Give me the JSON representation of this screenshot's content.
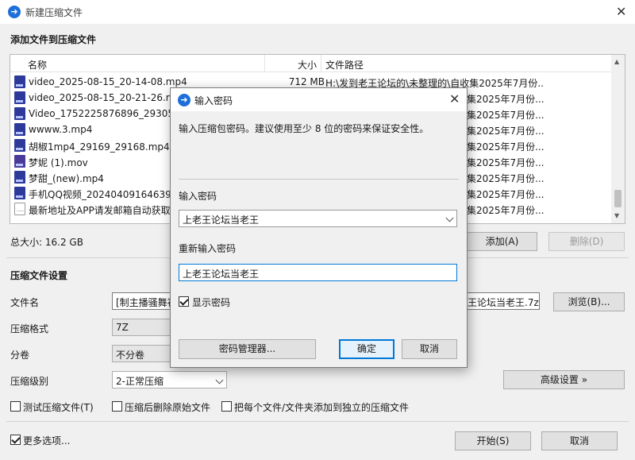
{
  "window": {
    "title": "新建压缩文件"
  },
  "add_section": {
    "title": "添加文件到压缩文件"
  },
  "file_list": {
    "columns": [
      "名称",
      "大小",
      "文件路径"
    ],
    "rows": [
      {
        "name": "video_2025-08-15_20-14-08.mp4",
        "size": "712 MB",
        "path": "H:\\发到老王论坛的\\未整理的\\自收集2025年7月份...",
        "type": "mp4"
      },
      {
        "name": "video_2025-08-15_20-21-26.mp4",
        "size": "",
        "path": "集2025年7月份...",
        "type": "mp4"
      },
      {
        "name": "Video_1752225876896_29305_2",
        "size": "",
        "path": "集2025年7月份...",
        "type": "mp4"
      },
      {
        "name": "wwww.3.mp4",
        "size": "",
        "path": "集2025年7月份...",
        "type": "mp4"
      },
      {
        "name": "胡椒1mp4_29169_29168.mp4",
        "size": "",
        "path": "集2025年7月份...",
        "type": "mp4"
      },
      {
        "name": "梦妮 (1).mov",
        "size": "",
        "path": "集2025年7月份...",
        "type": "mov"
      },
      {
        "name": "梦甜_(new).mp4",
        "size": "",
        "path": "集2025年7月份...",
        "type": "mp4"
      },
      {
        "name": "手机QQ视频_20240409164639.m",
        "size": "",
        "path": "集2025年7月份...",
        "type": "mp4"
      },
      {
        "name": "最新地址及APP请发邮箱自动获取!",
        "size": "",
        "path": "集2025年7月份...",
        "type": "txt"
      }
    ]
  },
  "total": {
    "label": "总大小: 16.2 GB"
  },
  "buttons": {
    "add": "添加(A)",
    "delete": "删除(D)",
    "browse": "浏览(B)...",
    "advanced": "高级设置 »",
    "start": "开始(S)",
    "cancel": "取消"
  },
  "settings": {
    "title": "压缩文件设置",
    "filename_label": "文件名",
    "filename_value_left": "[制主播骚舞福",
    "filename_value_right": "王论坛当老王.7z",
    "format_label": "压缩格式",
    "format_value": "7Z",
    "split_label": "分卷",
    "split_value": "不分卷",
    "level_label": "压缩级别",
    "level_value": "2-正常压缩"
  },
  "checkboxes": {
    "test": "测试压缩文件(T)",
    "delete_after": "压缩后删除原始文件",
    "each_separate": "把每个文件/文件夹添加到独立的压缩文件",
    "more_options": "更多选项..."
  },
  "dialog": {
    "title": "输入密码",
    "hint": "输入压缩包密码。建议使用至少 8 位的密码来保证安全性。",
    "password_label": "输入密码",
    "password_value": "上老王论坛当老王",
    "confirm_label": "重新输入密码",
    "confirm_value": "上老王论坛当老王",
    "show_password": "显示密码",
    "manager_button": "密码管理器...",
    "ok_button": "确定",
    "cancel_button": "取消"
  },
  "colors": {
    "accent": "#0078d7",
    "app_icon": "#1e6fd9"
  }
}
